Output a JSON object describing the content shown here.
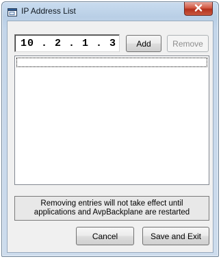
{
  "window": {
    "title": "IP Address List"
  },
  "ip_input": {
    "value": "10 . 2 . 1 . 3"
  },
  "buttons": {
    "add": "Add",
    "remove": "Remove",
    "cancel": "Cancel",
    "save_exit": "Save and Exit"
  },
  "ip_list": {
    "items": []
  },
  "notice": {
    "line1": "Removing entries will not take effect until",
    "line2": "applications and AvpBackplane are restarted"
  },
  "icons": {
    "title": "window-app-icon",
    "close": "close-icon"
  },
  "colors": {
    "close_button": "#c9402a",
    "titlebar": "#b9cfe6"
  }
}
